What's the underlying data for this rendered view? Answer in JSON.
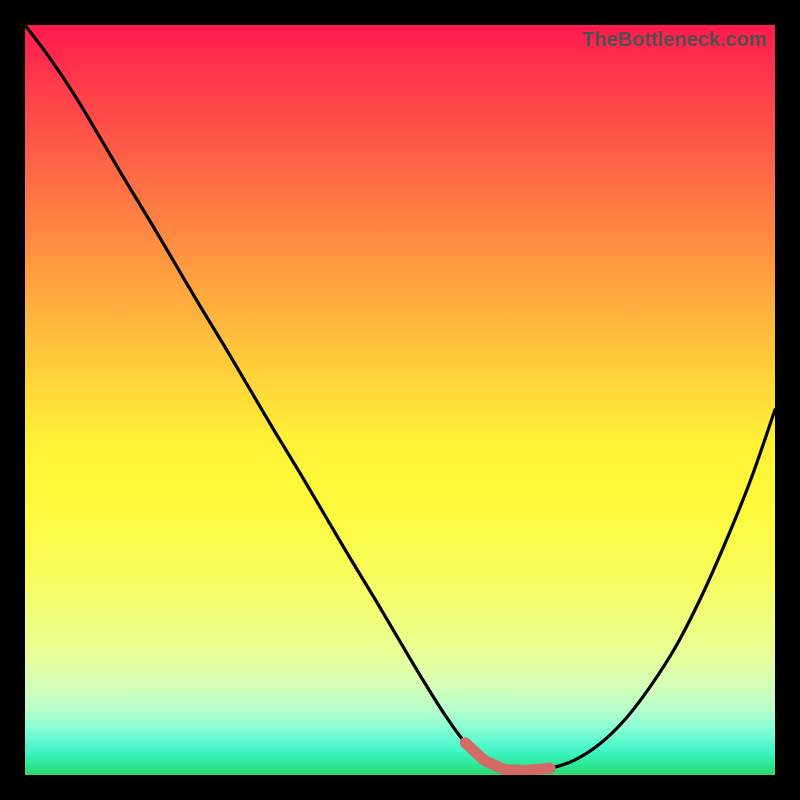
{
  "watermark": "TheBottleneck.com",
  "colors": {
    "frame": "#000000",
    "curve": "#000000",
    "highlight": "#d36a66",
    "gradient_top": "#ff1a4d",
    "gradient_bottom": "#2cd96e"
  },
  "chart_data": {
    "type": "line",
    "title": "",
    "xlabel": "",
    "ylabel": "",
    "xlim": [
      0,
      100
    ],
    "ylim": [
      0,
      100
    ],
    "grid": false,
    "legend": false,
    "series": [
      {
        "name": "bottleneck-curve",
        "x": [
          0.0,
          3.3,
          6.7,
          10.0,
          13.3,
          16.7,
          20.0,
          23.3,
          26.7,
          30.0,
          33.3,
          36.7,
          40.0,
          43.3,
          46.7,
          50.0,
          53.1,
          56.0,
          58.7,
          61.3,
          64.0,
          66.7,
          70.0,
          73.3,
          76.7,
          80.0,
          83.3,
          86.7,
          90.0,
          93.3,
          96.7,
          100.0
        ],
        "y": [
          100.0,
          95.6,
          90.5,
          85.0,
          79.4,
          73.8,
          68.2,
          62.6,
          57.0,
          51.4,
          45.8,
          40.2,
          34.6,
          29.0,
          23.4,
          17.8,
          12.6,
          8.0,
          4.3,
          1.9,
          0.7,
          0.6,
          0.9,
          2.0,
          4.2,
          7.4,
          11.7,
          17.0,
          23.4,
          30.8,
          39.2,
          48.7
        ]
      }
    ],
    "annotations": [
      {
        "name": "optimal-range",
        "type": "highlight-segment",
        "x_range": [
          58.7,
          70.0
        ],
        "color": "#d36a66"
      }
    ]
  }
}
